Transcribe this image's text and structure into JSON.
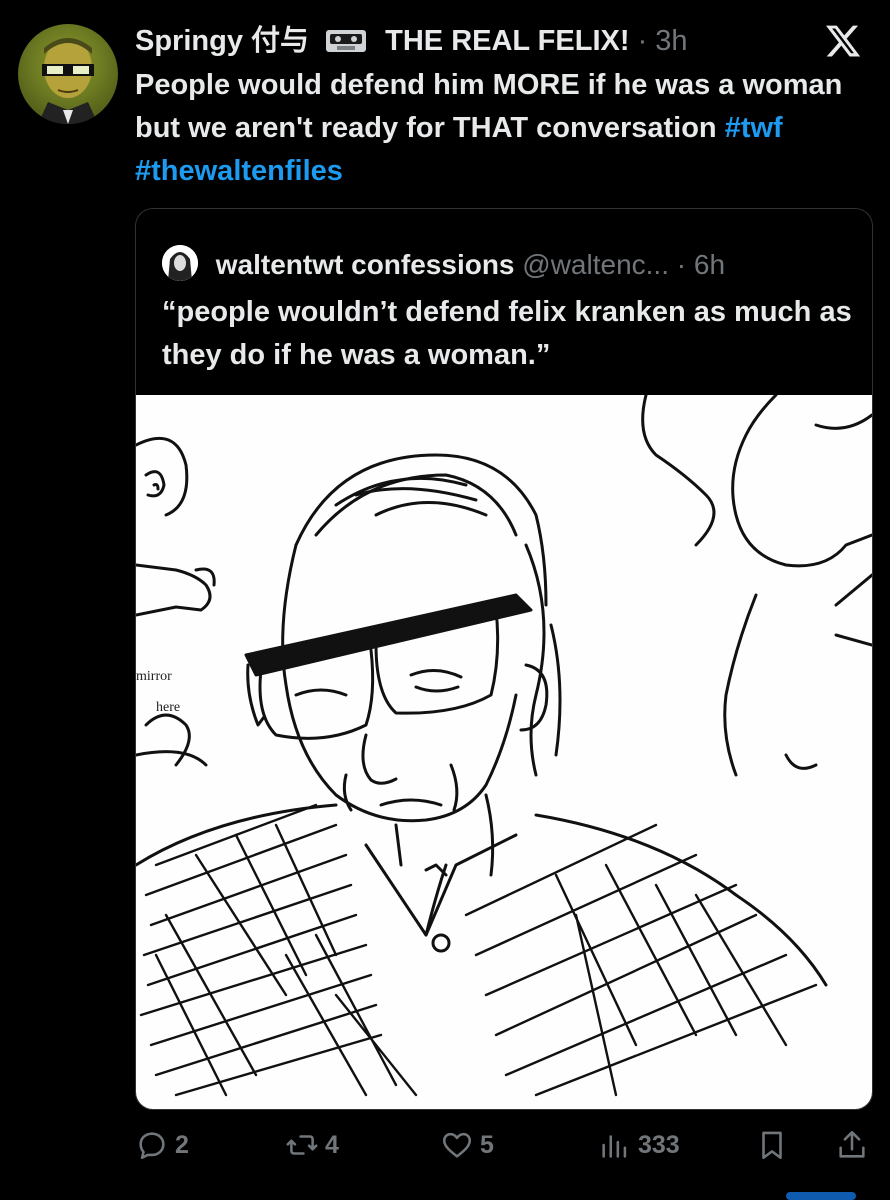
{
  "post": {
    "author_name": "Springy 付与",
    "author_tag": "THE REAL FELIX!",
    "time": "· 3h",
    "text": "People would defend him MORE if he was a woman but we aren't ready for THAT conversation",
    "hashtags": [
      "#twf",
      "#thewaltenfiles"
    ]
  },
  "quote": {
    "author": "waltentwt confessions",
    "handle": "@waltenc...",
    "time": "· 6h",
    "text": "“people wouldn’t defend felix kranken as much as they do if he was a woman.”",
    "image": {
      "note_line1": "mirror",
      "note_line2": "here"
    }
  },
  "actions": {
    "replies": "2",
    "reposts": "4",
    "likes": "5",
    "views": "333"
  },
  "icons": {
    "avatar": "avatar",
    "logo": "x-logo-icon",
    "tape": "videocassette-icon",
    "reply": "reply-icon",
    "repost": "repost-icon",
    "like": "heart-icon",
    "views": "views-chart-icon",
    "bookmark": "bookmark-icon",
    "share": "share-icon"
  },
  "colors": {
    "background": "#000000",
    "text": "#e7e9ea",
    "muted": "#71767b",
    "link": "#1d9bf0"
  }
}
